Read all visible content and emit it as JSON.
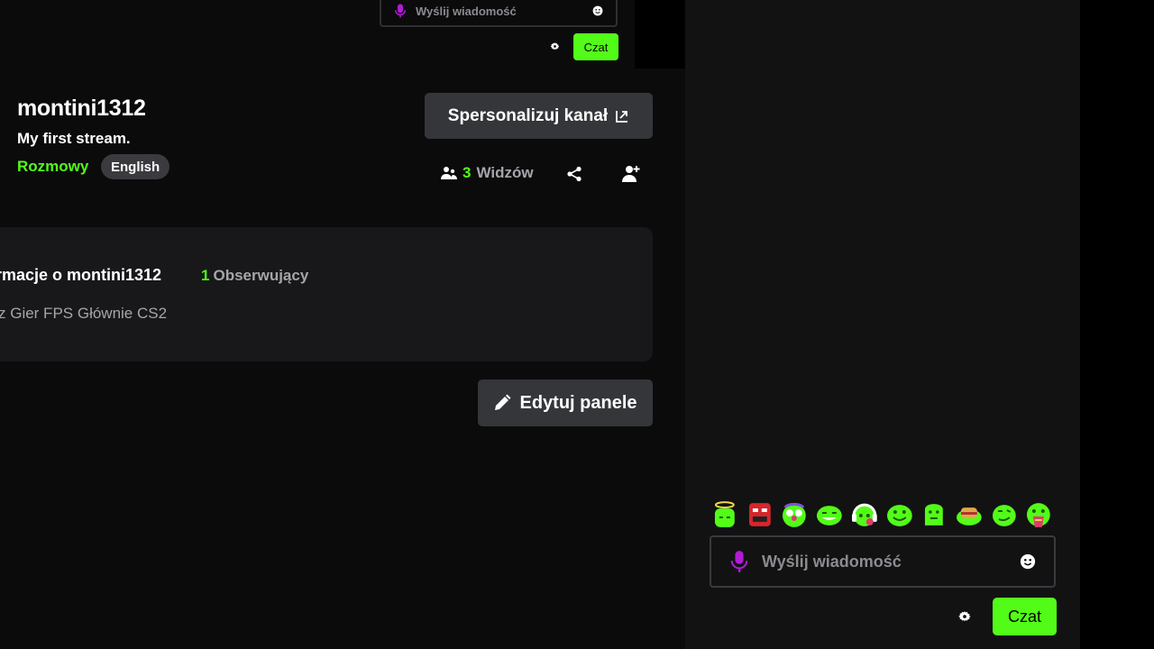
{
  "top_chat": {
    "placeholder": "Wyślij wiadomość",
    "send_label": "Czat"
  },
  "channel": {
    "name": "montini1312",
    "stream_title": "My first stream.",
    "category": "Rozmowy",
    "language": "English",
    "customize_label": "Spersonalizuj kanał",
    "viewers_count": "3",
    "viewers_label": "Widzów"
  },
  "about": {
    "title": "rmacje o montini1312",
    "followers_count": "1",
    "followers_label": "Obserwujący",
    "bio": "z Gier FPS Głównie CS2"
  },
  "edit_panels_label": "Edytuj panele",
  "chat": {
    "emotes": [
      "angel-emote",
      "angry-robot-emote",
      "clown-emote",
      "laughing-emote",
      "headphones-emote",
      "smile-emote",
      "plain-emote",
      "burger-emote",
      "smirk-emote",
      "rainbow-emote"
    ],
    "placeholder": "Wyślij wiadomość",
    "send_label": "Czat"
  },
  "colors": {
    "accent": "#53fc18",
    "background": "#0b0b0c",
    "panel": "#18181b",
    "button": "#35363a",
    "mic": "#b11bd8"
  }
}
